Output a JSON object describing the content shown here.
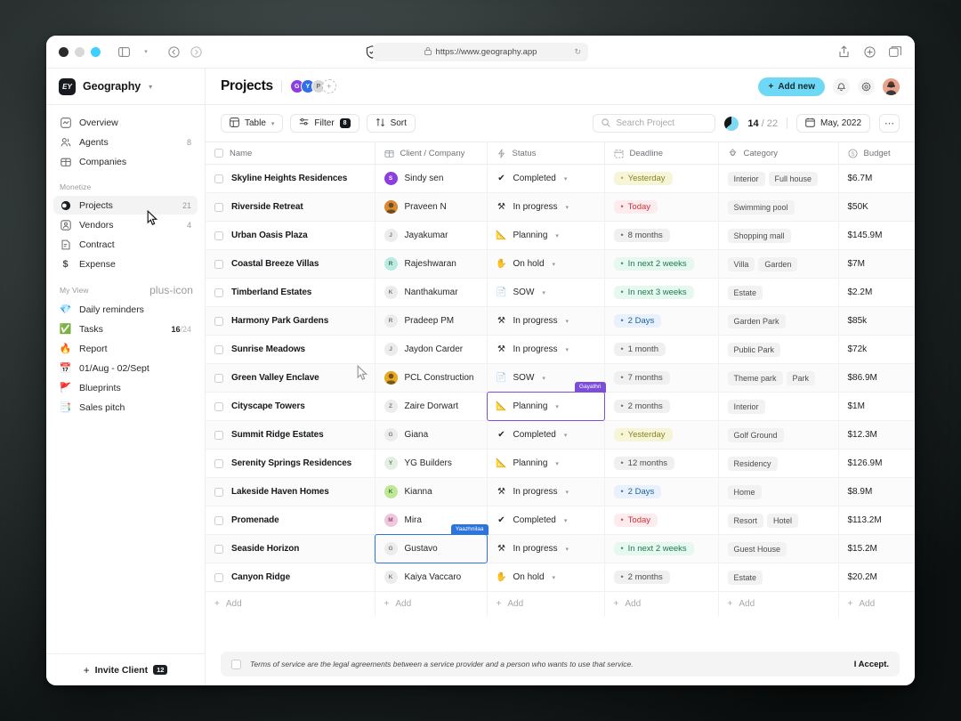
{
  "browser": {
    "url": "https://www.geography.app",
    "lock_icon": "lock-icon",
    "shield_icon": "shield-check-icon",
    "reload_icon": "reload-icon",
    "sidebar_toggle_icon": "sidebar-toggle-icon",
    "back_icon": "back-icon",
    "forward_icon": "forward-icon",
    "share_icon": "share-icon",
    "new_tab_icon": "new-tab-icon",
    "tabs_icon": "tabs-overview-icon"
  },
  "sidebar": {
    "brand": {
      "logo_text": "EY",
      "name": "Geography",
      "caret": "⌄"
    },
    "groups": [
      {
        "label": "",
        "items": [
          {
            "label": "Overview",
            "icon": "overview-icon",
            "count": ""
          },
          {
            "label": "Agents",
            "icon": "agents-icon",
            "count": "8"
          },
          {
            "label": "Companies",
            "icon": "companies-icon",
            "count": ""
          }
        ]
      },
      {
        "label": "Monetize",
        "items": [
          {
            "label": "Projects",
            "icon": "projects-icon",
            "count": "21",
            "active": true
          },
          {
            "label": "Vendors",
            "icon": "vendors-icon",
            "count": "4"
          },
          {
            "label": "Contract",
            "icon": "contract-icon",
            "count": ""
          },
          {
            "label": "Expense",
            "icon": "expense-icon",
            "count": ""
          }
        ]
      },
      {
        "label": "My View",
        "add_icon": "plus-icon",
        "items": [
          {
            "label": "Daily reminders",
            "emoji": "💎",
            "count": ""
          },
          {
            "label": "Tasks",
            "emoji": "✅",
            "count": "16",
            "count_total": "/24"
          },
          {
            "label": "Report",
            "emoji": "🔥",
            "count": ""
          },
          {
            "label": "01/Aug - 02/Sept",
            "emoji": "📅",
            "count": ""
          },
          {
            "label": "Blueprints",
            "emoji": "🚩",
            "count": ""
          },
          {
            "label": "Sales pitch",
            "emoji": "📑",
            "count": ""
          }
        ]
      }
    ],
    "footer": {
      "label": "Invite Client",
      "badge": "12",
      "plus": "+"
    }
  },
  "header": {
    "title": "Projects",
    "avatars": [
      {
        "initial": "G",
        "color": "#8b3fe0"
      },
      {
        "initial": "Y",
        "color": "#2f6fe8"
      },
      {
        "initial": "P",
        "color": "#d8d8d8",
        "text_color": "#6a6a6a"
      }
    ],
    "add_avatar": "+",
    "add_new_label": "Add new",
    "add_new_color": "#6fd8f5",
    "bell_icon": "bell-icon",
    "settings_icon": "gear-icon",
    "avatar_icon": "user-avatar"
  },
  "toolbar": {
    "view_label": "Table",
    "view_icon": "table-icon",
    "filter_label": "Filter",
    "filter_icon": "filter-icon",
    "filter_count": "8",
    "sort_label": "Sort",
    "sort_icon": "sort-icon",
    "search_placeholder": "Search Project",
    "search_value": "",
    "search_icon": "search-icon",
    "progress_done": "14",
    "progress_total": "/ 22",
    "date_label": "May, 2022",
    "date_icon": "calendar-icon",
    "more_icon": "ellipsis-icon"
  },
  "table": {
    "columns": [
      {
        "label": "Name",
        "icon": ""
      },
      {
        "label": "Client / Company",
        "icon": "building-icon"
      },
      {
        "label": "Status",
        "icon": "activity-icon"
      },
      {
        "label": "Deadline",
        "icon": "calendar-icon"
      },
      {
        "label": "Category",
        "icon": "shapes-icon"
      },
      {
        "label": "Budget",
        "icon": "dollar-icon"
      }
    ],
    "add_label": "Add",
    "rows": [
      {
        "name": "Skyline Heights Residences",
        "client": "Sindy sen",
        "client_initial": "S",
        "client_color": "#8b3fe0",
        "client_text": "#ffffff",
        "status": "Completed",
        "status_icon": "✔",
        "deadline": "Yesterday",
        "deadline_bg": "#f7f5d8",
        "deadline_fg": "#8a8320",
        "deadline_dot": "#b8af2a",
        "tags": [
          "Interior",
          "Full house"
        ],
        "budget": "$6.7M"
      },
      {
        "name": "Riverside Retreat",
        "client": "Praveen N",
        "client_initial": "",
        "client_color": "#d98a32",
        "client_text": "#ffffff",
        "client_photo": true,
        "status": "In progress",
        "status_icon": "⚒",
        "deadline": "Today",
        "deadline_bg": "#fdeced",
        "deadline_fg": "#d32f3f",
        "deadline_dot": "#e0434f",
        "tags": [
          "Swimming pool"
        ],
        "budget": "$50K"
      },
      {
        "name": "Urban Oasis Plaza",
        "client": "Jayakumar",
        "client_initial": "J",
        "client_color": "#ececec",
        "client_text": "#7a7a7a",
        "status": "Planning",
        "status_icon": "📐",
        "deadline": "8 months",
        "deadline_bg": "#f0f0f0",
        "deadline_fg": "#4a4d51",
        "deadline_dot": "#6b6e72",
        "tags": [
          "Shopping mall"
        ],
        "budget": "$145.9M"
      },
      {
        "name": "Coastal Breeze Villas",
        "client": "Rajeshwaran",
        "client_initial": "R",
        "client_color": "#b9ecdf",
        "client_text": "#3f6f63",
        "status": "On hold",
        "status_icon": "✋",
        "deadline": "In next 2 weeks",
        "deadline_bg": "#e6f8ef",
        "deadline_fg": "#1e7a53",
        "deadline_dot": "#2a9b68",
        "tags": [
          "Villa",
          "Garden"
        ],
        "budget": "$7M"
      },
      {
        "name": "Timberland Estates",
        "client": "Nanthakumar",
        "client_initial": "K",
        "client_color": "#ececec",
        "client_text": "#7a7a7a",
        "status": "SOW",
        "status_icon": "📄",
        "deadline": "In next 3 weeks",
        "deadline_bg": "#e6f8ef",
        "deadline_fg": "#1e7a53",
        "deadline_dot": "#2a9b68",
        "tags": [
          "Estate"
        ],
        "budget": "$2.2M"
      },
      {
        "name": "Harmony Park Gardens",
        "client": "Pradeep PM",
        "client_initial": "R",
        "client_color": "#ececec",
        "client_text": "#7a7a7a",
        "status": "In progress",
        "status_icon": "⚒",
        "deadline": "2 Days",
        "deadline_bg": "#e8f1fc",
        "deadline_fg": "#1f5fa8",
        "deadline_dot": "#2b74dd",
        "tags": [
          "Garden Park"
        ],
        "budget": "$85k"
      },
      {
        "name": "Sunrise Meadows",
        "client": "Jaydon Carder",
        "client_initial": "J",
        "client_color": "#ececec",
        "client_text": "#7a7a7a",
        "status": "In progress",
        "status_icon": "⚒",
        "deadline": "1 month",
        "deadline_bg": "#f0f0f0",
        "deadline_fg": "#4a4d51",
        "deadline_dot": "#6b6e72",
        "tags": [
          "Public Park"
        ],
        "budget": "$72k"
      },
      {
        "name": "Green Valley Enclave",
        "client": "PCL Construction",
        "client_initial": "",
        "client_color": "#e8a820",
        "client_text": "#4a3a00",
        "client_photo": true,
        "status": "SOW",
        "status_icon": "📄",
        "deadline": "7 months",
        "deadline_bg": "#f0f0f0",
        "deadline_fg": "#4a4d51",
        "deadline_dot": "#6b6e72",
        "tags": [
          "Theme park",
          "Park"
        ],
        "budget": "$86.9M"
      },
      {
        "name": "Cityscape Towers",
        "client": "Zaire Dorwart",
        "client_initial": "Z",
        "client_color": "#ececec",
        "client_text": "#7a7a7a",
        "status": "Planning",
        "status_icon": "📐",
        "status_selected": true,
        "status_tooltip": "Gayathri",
        "status_tooltip_color": "#7c4ddb",
        "deadline": "2 months",
        "deadline_bg": "#f0f0f0",
        "deadline_fg": "#4a4d51",
        "deadline_dot": "#6b6e72",
        "tags": [
          "Interior"
        ],
        "budget": "$1M"
      },
      {
        "name": "Summit Ridge Estates",
        "client": "Giana",
        "client_initial": "G",
        "client_color": "#ececec",
        "client_text": "#7a7a7a",
        "status": "Completed",
        "status_icon": "✔",
        "deadline": "Yesterday",
        "deadline_bg": "#f7f5d8",
        "deadline_fg": "#8a8320",
        "deadline_dot": "#b8af2a",
        "tags": [
          "Golf Ground"
        ],
        "budget": "$12.3M"
      },
      {
        "name": "Serenity Springs Residences",
        "client": "YG Builders",
        "client_initial": "Y",
        "client_color": "#e4efe4",
        "client_text": "#5f7a5f",
        "status": "Planning",
        "status_icon": "📐",
        "deadline": "12 months",
        "deadline_bg": "#f0f0f0",
        "deadline_fg": "#4a4d51",
        "deadline_dot": "#6b6e72",
        "tags": [
          "Residency"
        ],
        "budget": "$126.9M"
      },
      {
        "name": "Lakeside Haven Homes",
        "client": "Kianna",
        "client_initial": "K",
        "client_color": "#bfe896",
        "client_text": "#4e7033",
        "status": "In progress",
        "status_icon": "⚒",
        "deadline": "2 Days",
        "deadline_bg": "#e8f1fc",
        "deadline_fg": "#1f5fa8",
        "deadline_dot": "#2b74dd",
        "tags": [
          "Home"
        ],
        "budget": "$8.9M"
      },
      {
        "name": "Promenade",
        "client": "Mira",
        "client_initial": "M",
        "client_color": "#f0c7dc",
        "client_text": "#8a5570",
        "status": "Completed",
        "status_icon": "✔",
        "deadline": "Today",
        "deadline_bg": "#fdeced",
        "deadline_fg": "#d32f3f",
        "deadline_dot": "#e0434f",
        "tags": [
          "Resort",
          "Hotel"
        ],
        "budget": "$113.2M"
      },
      {
        "name": "Seaside Horizon",
        "client": "Gustavo",
        "client_initial": "G",
        "client_color": "#ececec",
        "client_text": "#7a7a7a",
        "client_selected": true,
        "client_tooltip": "Yaazhnilaa",
        "client_tooltip_color": "#2b74dd",
        "status": "In progress",
        "status_icon": "⚒",
        "deadline": "In next 2 weeks",
        "deadline_bg": "#e6f8ef",
        "deadline_fg": "#1e7a53",
        "deadline_dot": "#2a9b68",
        "tags": [
          "Guest House"
        ],
        "budget": "$15.2M"
      },
      {
        "name": "Canyon Ridge",
        "client": "Kaiya Vaccaro",
        "client_initial": "K",
        "client_color": "#ececec",
        "client_text": "#7a7a7a",
        "status": "On hold",
        "status_icon": "✋",
        "deadline": "2 months",
        "deadline_bg": "#f0f0f0",
        "deadline_fg": "#4a4d51",
        "deadline_dot": "#6b6e72",
        "tags": [
          "Estate"
        ],
        "budget": "$20.2M"
      }
    ]
  },
  "terms": {
    "text": "Terms of service are the legal agreements between a service provider and a person who wants to use that service.",
    "accept_label": "I Accept."
  }
}
